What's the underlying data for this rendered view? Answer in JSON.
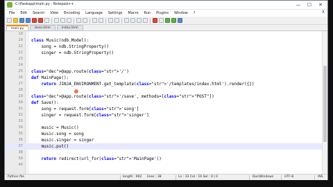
{
  "window": {
    "title": "C:\\flaskapp\\main.py - Notepad++",
    "controls": {
      "minimize": "—",
      "maximize": "☐",
      "close": "✕"
    }
  },
  "menu": [
    "File",
    "Edit",
    "Search",
    "View",
    "Encoding",
    "Language",
    "Settings",
    "Macro",
    "Run",
    "Plugins",
    "Window",
    "?"
  ],
  "close_doc": "X",
  "tabs": [
    {
      "label": "main.py",
      "active": true
    },
    {
      "label": "base.html",
      "active": false
    },
    {
      "label": "index.html",
      "active": false
    }
  ],
  "editor": {
    "lines": [
      {
        "n": "19",
        "code": ""
      },
      {
        "n": "20",
        "code": "class Music(ndb.Model):"
      },
      {
        "n": "21",
        "code": "    song = ndb.StringProperty()"
      },
      {
        "n": "22",
        "code": "    singer = ndb.StringProperty()"
      },
      {
        "n": "23",
        "code": ""
      },
      {
        "n": "24",
        "code": ""
      },
      {
        "n": "25",
        "code": "@app.route('/')"
      },
      {
        "n": "26",
        "code": "def MainPage():"
      },
      {
        "n": "27",
        "code": "    return JINJA_ENVIRONMENT.get_template('/templates/index.html').render({})"
      },
      {
        "n": "28",
        "code": ""
      },
      {
        "n": "29",
        "code": "@app.route('/save', methods=[\"POST\"])"
      },
      {
        "n": "30",
        "code": "def Save():"
      },
      {
        "n": "31",
        "code": "    song = request.form['song']"
      },
      {
        "n": "32",
        "code": "    singer = request.form['singer']"
      },
      {
        "n": "33",
        "code": ""
      },
      {
        "n": "34",
        "code": "    music = Music()"
      },
      {
        "n": "35",
        "code": "    music.song = song"
      },
      {
        "n": "36",
        "code": "    music.singer = singer"
      },
      {
        "n": "37",
        "code": "    music.put()"
      },
      {
        "n": "38",
        "code": ""
      },
      {
        "n": "39",
        "code": "    return redirect(url_for('MainPage'))"
      },
      {
        "n": "40",
        "code": ""
      }
    ],
    "current_line": "37"
  },
  "status": {
    "file_type": "Python file",
    "length": "length : 902",
    "lines": "lines : 38",
    "position": "Ln : 33   Col : 16   Sel : 0 | 0",
    "eol": "Dos\\Windows",
    "encoding": "UTF-8",
    "mode": "INS"
  },
  "colors": {
    "keyword": "#0000ff",
    "decorator": "#ff8000",
    "string": "#808080",
    "tab_accent": "#f08c00",
    "current_line": "#e8e8ff"
  }
}
